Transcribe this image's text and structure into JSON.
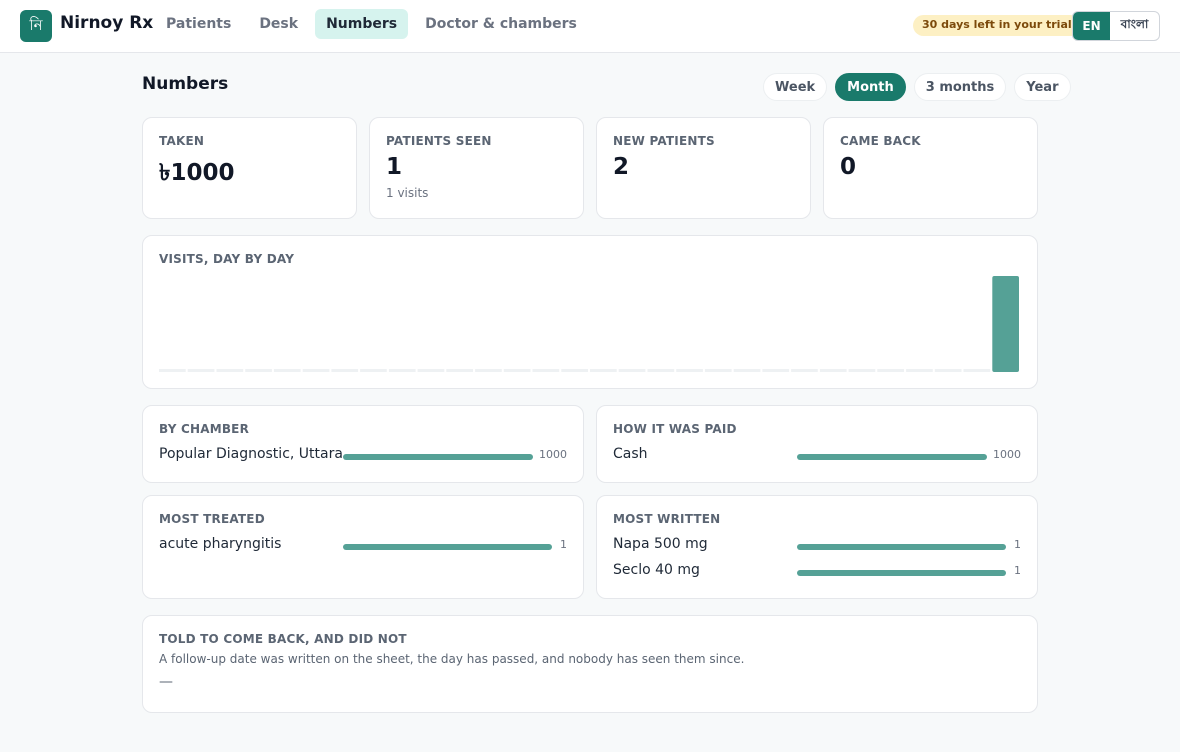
{
  "app": {
    "logo_glyph": "নি",
    "name": "Nirnoy Rx"
  },
  "nav": [
    {
      "label": "Patients",
      "active": false
    },
    {
      "label": "Desk",
      "active": false
    },
    {
      "label": "Numbers",
      "active": true
    },
    {
      "label": "Doctor & chambers",
      "active": false
    }
  ],
  "trial_badge": "30 days left in your trial",
  "language": {
    "current": "EN",
    "other": "বাংলা"
  },
  "page": {
    "title": "Numbers"
  },
  "periods": [
    {
      "label": "Week",
      "active": false
    },
    {
      "label": "Month",
      "active": true
    },
    {
      "label": "3 months",
      "active": false
    },
    {
      "label": "Year",
      "active": false
    }
  ],
  "stats": {
    "taken": {
      "label": "TAKEN",
      "value": "৳1000"
    },
    "patients_seen": {
      "label": "PATIENTS SEEN",
      "value": "1",
      "sub": "1 visits"
    },
    "new_patients": {
      "label": "NEW PATIENTS",
      "value": "2"
    },
    "came_back": {
      "label": "CAME BACK",
      "value": "0"
    }
  },
  "visits_chart": {
    "label": "VISITS, DAY BY DAY"
  },
  "chart_data": {
    "type": "bar",
    "values": [
      0,
      0,
      0,
      0,
      0,
      0,
      0,
      0,
      0,
      0,
      0,
      0,
      0,
      0,
      0,
      0,
      0,
      0,
      0,
      0,
      0,
      0,
      0,
      0,
      0,
      0,
      0,
      0,
      0,
      1
    ],
    "bar_color": "#55a196",
    "empty_color": "#eef1f3"
  },
  "by_chamber": {
    "label": "BY CHAMBER",
    "rows": [
      {
        "name": "Popular Diagnostic, Uttara",
        "value": "1000",
        "fraction": 1
      }
    ]
  },
  "how_paid": {
    "label": "HOW IT WAS PAID",
    "rows": [
      {
        "name": "Cash",
        "value": "1000",
        "fraction": 1
      }
    ]
  },
  "most_treated": {
    "label": "MOST TREATED",
    "rows": [
      {
        "name": "acute pharyngitis",
        "value": "1",
        "fraction": 1
      }
    ]
  },
  "most_written": {
    "label": "MOST WRITTEN",
    "rows": [
      {
        "name": "Napa 500 mg",
        "value": "1",
        "fraction": 1
      },
      {
        "name": "Seclo 40 mg",
        "value": "1",
        "fraction": 1
      }
    ]
  },
  "missed_followups": {
    "label": "TOLD TO COME BACK, AND DID NOT",
    "note": "A follow-up date was written on the sheet, the day has passed, and nobody has seen them since.",
    "empty": "—"
  },
  "colors": {
    "accent": "#1a7a6b",
    "accent_light": "#d6f3ee",
    "bar": "#55a196"
  }
}
